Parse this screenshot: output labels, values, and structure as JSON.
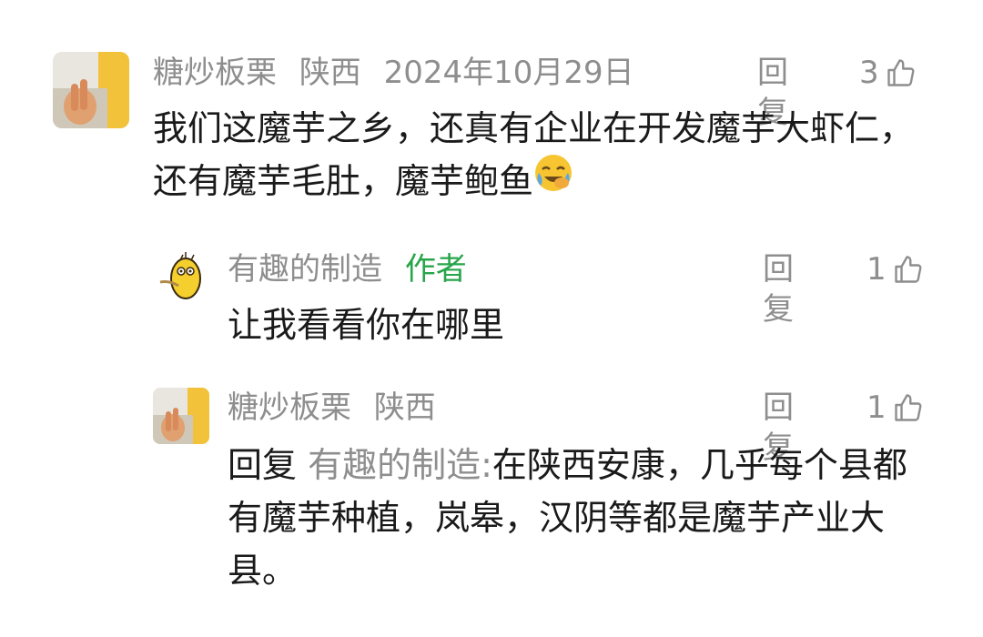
{
  "comments": [
    {
      "username": "糖炒板栗",
      "location": "陕西",
      "date": "2024年10月29日",
      "reply_label": "回复",
      "likes": "3",
      "text": "我们这魔芋之乡，还真有企业在开发魔芋大虾仁，还有魔芋毛肚，魔芋鲍鱼",
      "emoji": "crying-laughing-emoji"
    },
    {
      "username": "有趣的制造",
      "author_tag": "作者",
      "reply_label": "回复",
      "likes": "1",
      "text": "让我看看你在哪里"
    },
    {
      "username": "糖炒板栗",
      "location": "陕西",
      "reply_label": "回复",
      "likes": "1",
      "reply_prefix": "回复",
      "reply_target": "有趣的制造:",
      "text": "在陕西安康，几乎每个县都有魔芋种植，岚皋，汉阴等都是魔芋产业大县。"
    }
  ]
}
